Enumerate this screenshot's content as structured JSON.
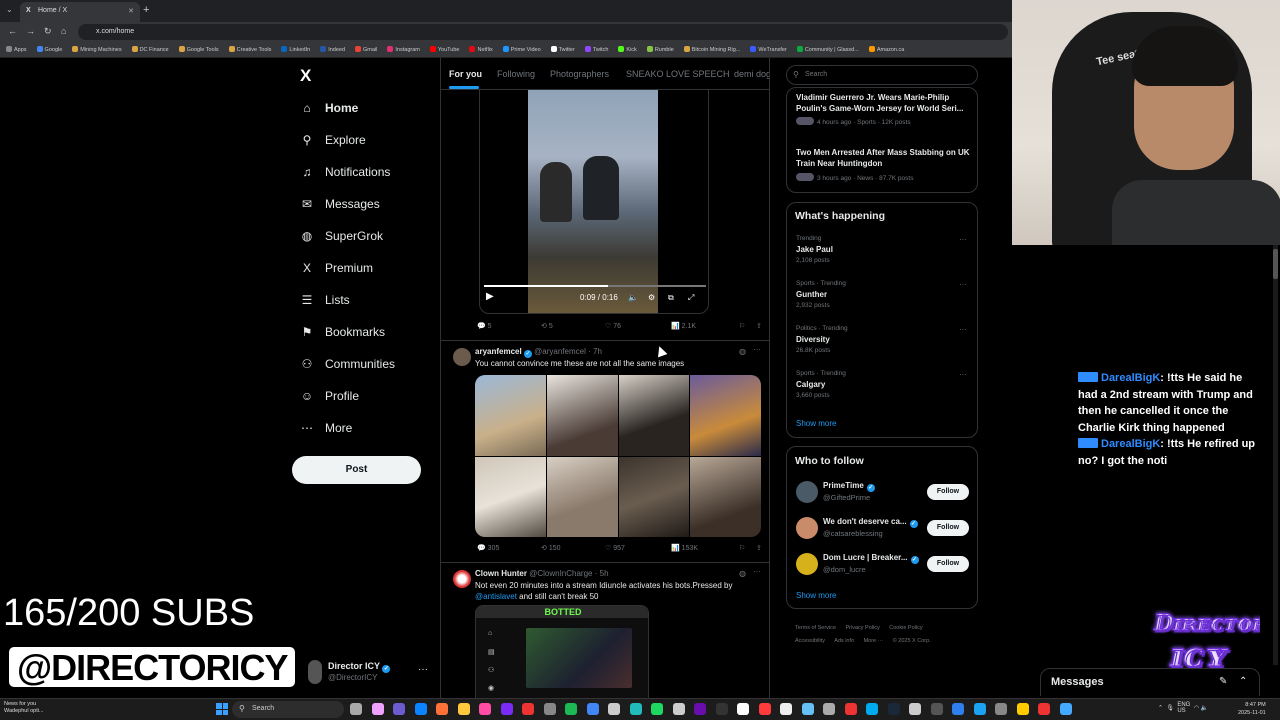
{
  "browser": {
    "tab_title": "Home / X",
    "url": "x.com/home",
    "bookmarks": [
      "Apps",
      "Google",
      "Mining Machines",
      "DC Finance",
      "Google Tools",
      "Creative Tools",
      "LinkedIn",
      "Indeed",
      "Gmail",
      "Instagram",
      "YouTube",
      "Netflix",
      "Prime Video",
      "Twitter",
      "Twitch",
      "Kick",
      "Rumble",
      "Bitcoin Mining Rig...",
      "WeTransfer",
      "Community | Glassd...",
      "Amazon.ca"
    ]
  },
  "sidebar": {
    "logo": "X",
    "items": [
      {
        "label": "Home",
        "icon": "home-icon",
        "glyph": "⌂"
      },
      {
        "label": "Explore",
        "icon": "search-icon",
        "glyph": "⚲"
      },
      {
        "label": "Notifications",
        "icon": "bell-icon",
        "glyph": "♫"
      },
      {
        "label": "Messages",
        "icon": "mail-icon",
        "glyph": "✉"
      },
      {
        "label": "SuperGrok",
        "icon": "grok-icon",
        "glyph": "◍"
      },
      {
        "label": "Premium",
        "icon": "x-premium-icon",
        "glyph": "X"
      },
      {
        "label": "Lists",
        "icon": "list-icon",
        "glyph": "☰"
      },
      {
        "label": "Bookmarks",
        "icon": "bookmark-icon",
        "glyph": "⚑"
      },
      {
        "label": "Communities",
        "icon": "people-icon",
        "glyph": "⚇"
      },
      {
        "label": "Profile",
        "icon": "person-icon",
        "glyph": "☺"
      },
      {
        "label": "More",
        "icon": "more-circle-icon",
        "glyph": "⋯"
      }
    ],
    "post_label": "Post",
    "account": {
      "name": "Director ICY",
      "handle": "@DirectorICY",
      "more": "···"
    }
  },
  "overlay": {
    "subs": "165/200 SUBS",
    "handle": "@DIRECTORICY",
    "logo": "DIRECTOR ICY"
  },
  "feed": {
    "tabs": [
      "For you",
      "Following",
      "Photographers",
      "SNEAKO LOVE SPEECH",
      "demi dog"
    ],
    "video": {
      "time": "0:09 / 0:16",
      "progress": 0.56
    },
    "tweet0_actions": {
      "replies": "5",
      "reposts": "5",
      "likes": "76",
      "views": "2.1K"
    },
    "tweet1": {
      "name": "aryanfemcel",
      "handle": "@aryanfemcel",
      "time": "· 7h",
      "text": "You cannot convince me these are not all the same images",
      "replies": "305",
      "reposts": "150",
      "likes": "957",
      "views": "153K"
    },
    "tweet2": {
      "name": "Clown Hunter",
      "handle": "@ClownInCharge",
      "time": "· 5h",
      "text_a": "Not even 20 minutes into a stream Idiuncle activates his bots.Pressed by",
      "mention": "@antislavet",
      "text_b": " and still can't break 50",
      "embed_banner": "BOTTED"
    }
  },
  "right": {
    "search_placeholder": "Search",
    "news": [
      {
        "title": "Vladimir Guerrero Jr. Wears Marie-Philip Poulin's Game-Worn Jersey for World Seri...",
        "meta": "4 hours ago · Sports · 12K posts"
      },
      {
        "title": "Two Men Arrested After Mass Stabbing on UK Train Near Huntingdon",
        "meta": "3 hours ago · News · 87.7K posts"
      }
    ],
    "whats_happening": "What's happening",
    "trends": [
      {
        "cat": "Trending",
        "name": "Jake Paul",
        "count": "2,108 posts"
      },
      {
        "cat": "Sports · Trending",
        "name": "Gunther",
        "count": "2,932 posts"
      },
      {
        "cat": "Politics · Trending",
        "name": "Diversity",
        "count": "26.8K posts"
      },
      {
        "cat": "Sports · Trending",
        "name": "Calgary",
        "count": "3,660 posts"
      }
    ],
    "show_more": "Show more",
    "who_to_follow": "Who to follow",
    "follow_label": "Follow",
    "suggestions": [
      {
        "name": "PrimeTime",
        "handle": "@GiftedPrime",
        "color": "#4a5a66"
      },
      {
        "name": "We don't deserve ca...",
        "handle": "@catsareblessing",
        "color": "#c98b6a"
      },
      {
        "name": "Dom Lucre | Breaker...",
        "handle": "@dom_lucre",
        "color": "#d6b11c"
      }
    ],
    "footer": [
      "Terms of Service",
      "Privacy Policy",
      "Cookie Policy",
      "Accessibility",
      "Ads info",
      "More ···",
      "© 2025 X Corp."
    ]
  },
  "webcam": {
    "chair_text": "Tee seat"
  },
  "chat": [
    {
      "user": "DarealBigK",
      "text": ": !tts He said he had a 2nd stream with Trump and then he cancelled it once the Charlie Kirk thing happened"
    },
    {
      "user": "DarealBigK",
      "text": ": !tts He refired up no? I got the noti"
    }
  ],
  "messages_drawer": {
    "label": "Messages"
  },
  "taskbar": {
    "news_title": "News for you",
    "news_sub": "Wadephul opti...",
    "search": "Search",
    "lang": "ENG",
    "region": "US",
    "time": "8:47 PM",
    "date": "2025-11-01"
  }
}
